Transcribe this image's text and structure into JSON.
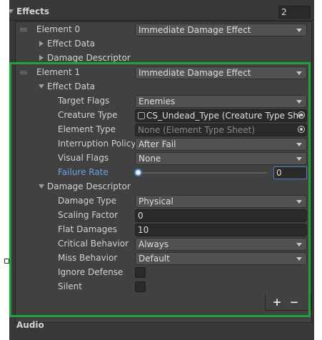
{
  "effects_header": {
    "label": "Effects",
    "count": "2"
  },
  "element0": {
    "label": "Element 0",
    "type_value": "Immediate Damage Effect",
    "children": [
      "Effect Data",
      "Damage Descriptor"
    ]
  },
  "element1": {
    "label": "Element 1",
    "type_value": "Immediate Damage Effect",
    "effect_data": {
      "label": "Effect Data",
      "target_flags": {
        "label": "Target Flags",
        "value": "Enemies"
      },
      "creature_type": {
        "label": "Creature Type",
        "value": "CS_Undead_Type (Creature Type She"
      },
      "element_type": {
        "label": "Element Type",
        "value": "None (Element Type Sheet)"
      },
      "interruption_policy": {
        "label": "Interruption Policy",
        "value": "After Fail"
      },
      "visual_flags": {
        "label": "Visual Flags",
        "value": "None"
      },
      "failure_rate": {
        "label": "Failure Rate",
        "value": "0",
        "slider_fraction": 0
      }
    },
    "damage_descriptor": {
      "label": "Damage Descriptor",
      "damage_type": {
        "label": "Damage Type",
        "value": "Physical"
      },
      "scaling_factor": {
        "label": "Scaling Factor",
        "value": "0"
      },
      "flat_damages": {
        "label": "Flat Damages",
        "value": "10"
      },
      "critical_behavior": {
        "label": "Critical Behavior",
        "value": "Always"
      },
      "miss_behavior": {
        "label": "Miss Behavior",
        "value": "Default"
      },
      "ignore_defense": {
        "label": "Ignore Defense",
        "checked": false
      },
      "silent": {
        "label": "Silent",
        "checked": false
      }
    }
  },
  "list_footer": {
    "add_label": "+",
    "remove_label": "−"
  },
  "next_section": {
    "label": "Audio"
  },
  "colors": {
    "highlight": "#22a03a",
    "focused_label": "#6d9ee6"
  },
  "icons": {
    "creature_type_icon": "scriptable-object-icon"
  }
}
